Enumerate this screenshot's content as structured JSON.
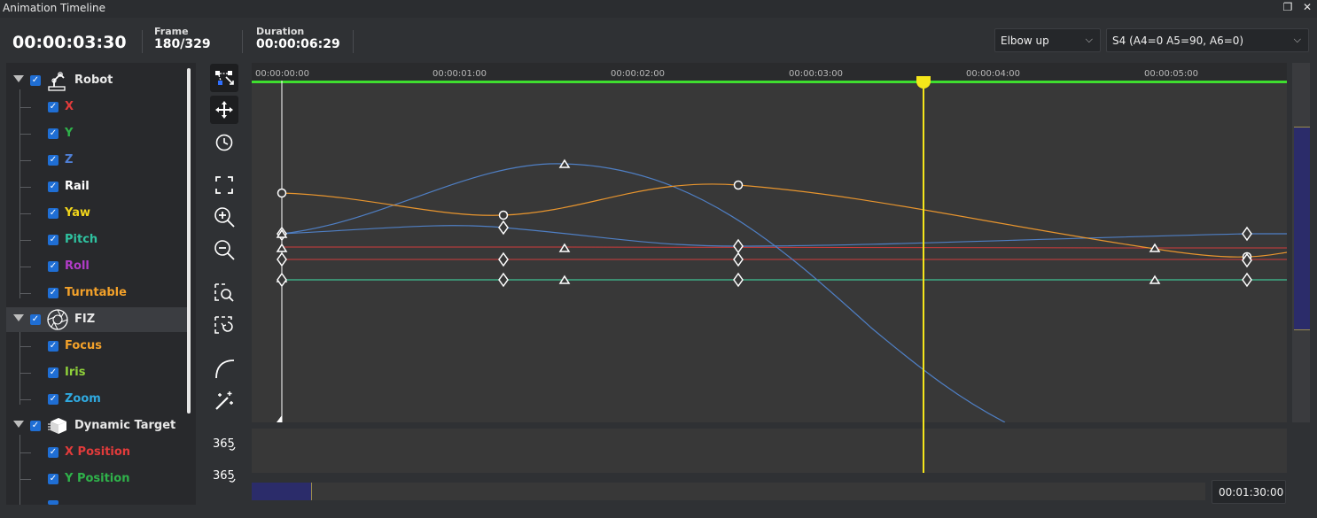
{
  "window": {
    "title": "Animation Timeline",
    "restore_glyph": "❐",
    "close_glyph": "✕"
  },
  "header": {
    "current_time": "00:00:03:30",
    "frame_label": "Frame",
    "frame_value": "180/329",
    "duration_label": "Duration",
    "duration_value": "00:00:06:29",
    "config_select": "Elbow up",
    "pose_select": "S4 (A4=0 A5=90, A6=0)"
  },
  "tree": {
    "check": "✓",
    "items": [
      {
        "label": "Robot",
        "color": "#ffffff",
        "level": 0,
        "icon": "robot-arm-icon"
      },
      {
        "label": "X",
        "color": "#e23b3b",
        "level": 1
      },
      {
        "label": "Y",
        "color": "#2fb24a",
        "level": 1
      },
      {
        "label": "Z",
        "color": "#4f7fd6",
        "level": 1
      },
      {
        "label": "Rail",
        "color": "#ffffff",
        "level": 1
      },
      {
        "label": "Yaw",
        "color": "#f1d51b",
        "level": 1
      },
      {
        "label": "Pitch",
        "color": "#2fc2a0",
        "level": 1
      },
      {
        "label": "Roll",
        "color": "#b23cc9",
        "level": 1
      },
      {
        "label": "Turntable",
        "color": "#f3a12a",
        "level": 1
      },
      {
        "label": "FIZ",
        "color": "#ffffff",
        "level": 0,
        "icon": "lens-aperture-icon"
      },
      {
        "label": "Focus",
        "color": "#f3a12a",
        "level": 1
      },
      {
        "label": "Iris",
        "color": "#8fd13a",
        "level": 1
      },
      {
        "label": "Zoom",
        "color": "#2fa9e0",
        "level": 1
      },
      {
        "label": "Dynamic Target",
        "color": "#ffffff",
        "level": 0,
        "icon": "cube-icon"
      },
      {
        "label": "X Position",
        "color": "#e23b3b",
        "level": 1
      },
      {
        "label": "Y Position",
        "color": "#2fb24a",
        "level": 1
      }
    ]
  },
  "timeline": {
    "ruler_ticks": [
      "00:00:00:00",
      "00:00:01:00",
      "00:00:02:00",
      "00:00:03:00",
      "00:00:04:00",
      "00:00:05:00"
    ],
    "playhead_time": "00:00:03:30",
    "end_time": "00:01:30:00",
    "curve_colors": {
      "orange": "#e8952e",
      "blue": "#4f7fc4",
      "red": "#cf3b3b",
      "green": "#3fc293"
    }
  },
  "tools": [
    {
      "name": "curve-edit-tool-icon",
      "active": true
    },
    {
      "name": "move-keys-tool-icon",
      "active": true
    },
    {
      "name": "time-tool-icon",
      "active": false
    },
    {
      "name": "fit-view-icon",
      "active": false
    },
    {
      "name": "zoom-in-icon",
      "active": false
    },
    {
      "name": "zoom-out-icon",
      "active": false
    },
    {
      "name": "zoom-selection-icon",
      "active": false
    },
    {
      "name": "reset-view-icon",
      "active": false
    },
    {
      "name": "curve-interpolation-icon",
      "active": false
    },
    {
      "name": "magic-wand-icon",
      "active": false
    },
    {
      "name": "365-a-icon",
      "active": false
    },
    {
      "name": "365-b-icon",
      "active": false
    }
  ]
}
